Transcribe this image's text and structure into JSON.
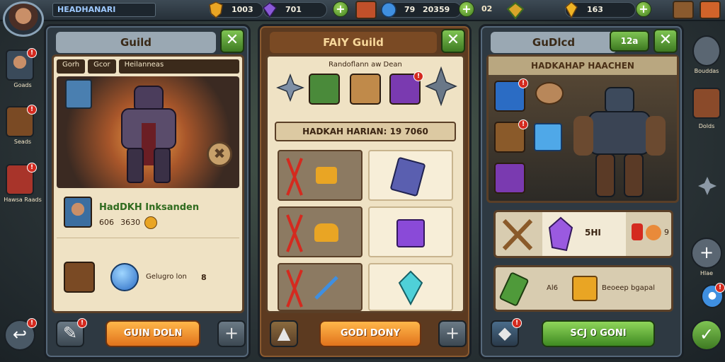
{
  "topbar": {
    "player_name": "HEADHANARI",
    "resources": [
      {
        "name": "gold",
        "value": "1003",
        "icon": "gold-shield-icon"
      },
      {
        "name": "gems",
        "value": "701",
        "icon": "purple-gem-icon"
      },
      {
        "name": "crystals",
        "value": "79",
        "icon": "blue-gem-icon"
      },
      {
        "name": "coins",
        "value": "20359",
        "icon": ""
      },
      {
        "name": "extra",
        "value": "02",
        "icon": ""
      },
      {
        "name": "energy",
        "value": "163",
        "icon": "gold-crystal-icon"
      }
    ]
  },
  "left_panel": {
    "title": "Guild",
    "tabs": [
      "Gorh",
      "Gcor",
      "Heilanneas"
    ],
    "member_name": "HadDKH Inksanden",
    "member_stats": "606   3630",
    "footer_text": "Gelugro lon",
    "footer_count": "8",
    "button": "GUIN DOLN"
  },
  "middle_panel": {
    "title": "FAIY Guild",
    "subtitle": "Randoflann aw Dean",
    "banner": "HADKAH HARIAN: 19 7060",
    "button": "GODI DONY"
  },
  "right_panel": {
    "title": "GuDlcd",
    "count": "12a",
    "header": "HADKAHAP HAACHEN",
    "row1_text": "5HI",
    "row1_count": "9",
    "row2_prefix": "Al6",
    "row2_text": "Beoeep bgapal",
    "button": "SCJ 0 GONI"
  },
  "sidebar_left": [
    {
      "label": "Goads"
    },
    {
      "label": "Seads"
    },
    {
      "label": "Hawsa Raads"
    }
  ],
  "sidebar_right": [
    {
      "label": "Bouddas"
    },
    {
      "label": "Dolds"
    },
    {
      "label": "Hlae"
    }
  ],
  "badges": {
    "alert": "!"
  },
  "colors": {
    "accent_green": "#5fa834",
    "accent_orange": "#f0902a",
    "parchment": "#efe2c4"
  }
}
